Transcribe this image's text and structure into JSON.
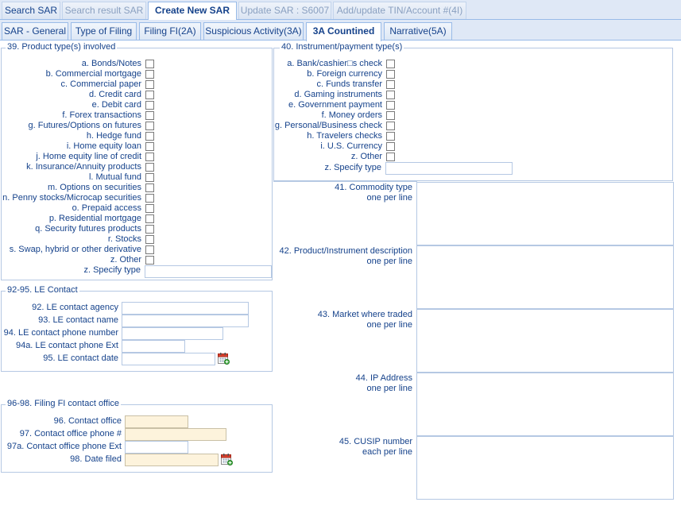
{
  "top_tabs": [
    {
      "label": "Search SAR"
    },
    {
      "label": "Search result SAR"
    },
    {
      "label": "Create New SAR"
    },
    {
      "label": "Update SAR : S6007"
    },
    {
      "label": "Add/update TIN/Account #(4I)"
    }
  ],
  "sub_tabs": [
    {
      "label": "SAR - General"
    },
    {
      "label": "Type of Filing"
    },
    {
      "label": "Filing FI(2A)"
    },
    {
      "label": "Suspicious Activity(3A)"
    },
    {
      "label": "3A Countined"
    },
    {
      "label": "Narrative(5A)"
    }
  ],
  "product_types": {
    "legend": "39. Product type(s) involved",
    "items": [
      "a. Bonds/Notes",
      "b. Commercial mortgage",
      "c. Commercial paper",
      "d. Credit card",
      "e. Debit card",
      "f. Forex transactions",
      "g. Futures/Options on futures",
      "h. Hedge fund",
      "i. Home equity loan",
      "j. Home equity line of credit",
      "k. Insurance/Annuity products",
      "l. Mutual fund",
      "m. Options on securities",
      "n. Penny stocks/Microcap securities",
      "o. Prepaid access",
      "p. Residential mortgage",
      "q. Security futures products",
      "r. Stocks",
      "s. Swap, hybrid or other derivative",
      "z. Other"
    ],
    "specify_label": "z. Specify type"
  },
  "instrument_types": {
    "legend": "40. Instrument/payment type(s)",
    "items": [
      "a. Bank/cashier□s check",
      "b. Foreign currency",
      "c. Funds transfer",
      "d. Gaming instruments",
      "e. Government payment",
      "f. Money orders",
      "g. Personal/Business check",
      "h. Travelers checks",
      "i. U.S. Currency",
      "z. Other"
    ],
    "specify_label": "z. Specify type"
  },
  "le_contact": {
    "legend": "92-95. LE Contact",
    "agency_label": "92. LE contact agency",
    "name_label": "93. LE contact name",
    "phone_label": "94. LE contact phone number",
    "ext_label": "94a. LE contact phone Ext",
    "date_label": "95. LE contact date"
  },
  "filing_fi": {
    "legend": "96-98. Filing FI contact office",
    "office_label": "96. Contact office",
    "phone_label": "97. Contact office phone #",
    "ext_label": "97a. Contact office phone Ext",
    "date_label": "98. Date filed"
  },
  "right_fields": [
    {
      "line1": "41. Commodity type",
      "line2": "one per line"
    },
    {
      "line1": "42. Product/Instrument description",
      "line2": "one per line"
    },
    {
      "line1": "43. Market where traded",
      "line2": "one per line"
    },
    {
      "line1": "44. IP Address",
      "line2": "one per line"
    },
    {
      "line1": "45. CUSIP number",
      "line2": "each per line"
    }
  ],
  "icons": {
    "calendar": "calendar-icon"
  },
  "colors": {
    "text": "#15428b",
    "tab_bg": "#dfe8f6",
    "border": "#99bbe8",
    "required_bg": "#fdf3dc"
  }
}
